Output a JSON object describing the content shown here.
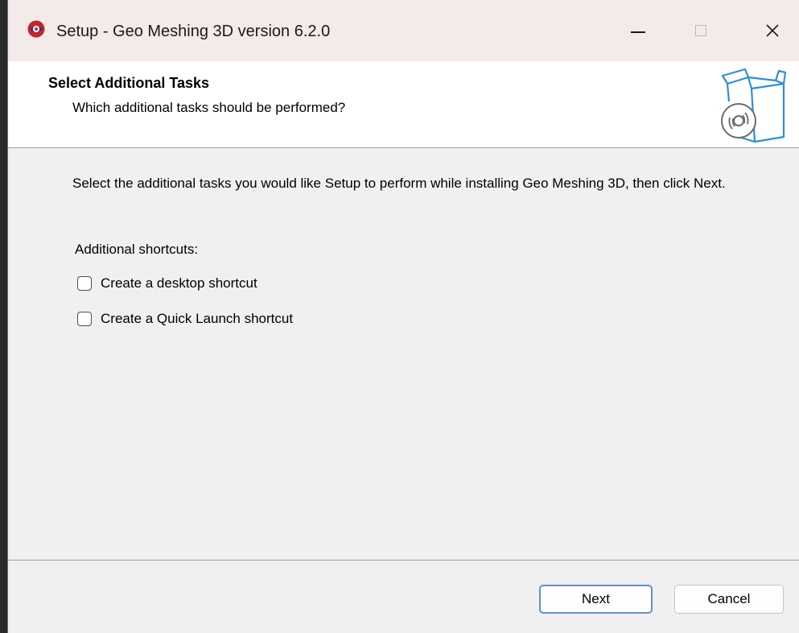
{
  "window": {
    "title": "Setup - Geo Meshing 3D version 6.2.0",
    "controls": {
      "minimize": "—",
      "close": "✕"
    }
  },
  "header": {
    "title": "Select Additional Tasks",
    "subtitle": "Which additional tasks should be performed?"
  },
  "main": {
    "description": "Select the additional tasks you would like Setup to perform while installing Geo Meshing 3D, then click Next.",
    "section_label": "Additional shortcuts:",
    "tasks": [
      {
        "label": "Create a desktop shortcut",
        "checked": false
      },
      {
        "label": "Create a Quick Launch shortcut",
        "checked": false
      }
    ]
  },
  "footer": {
    "next_label": "Next",
    "cancel_label": "Cancel"
  },
  "colors": {
    "primary_border": "#5f92c9",
    "graphic_blue": "#2f8fd8"
  }
}
